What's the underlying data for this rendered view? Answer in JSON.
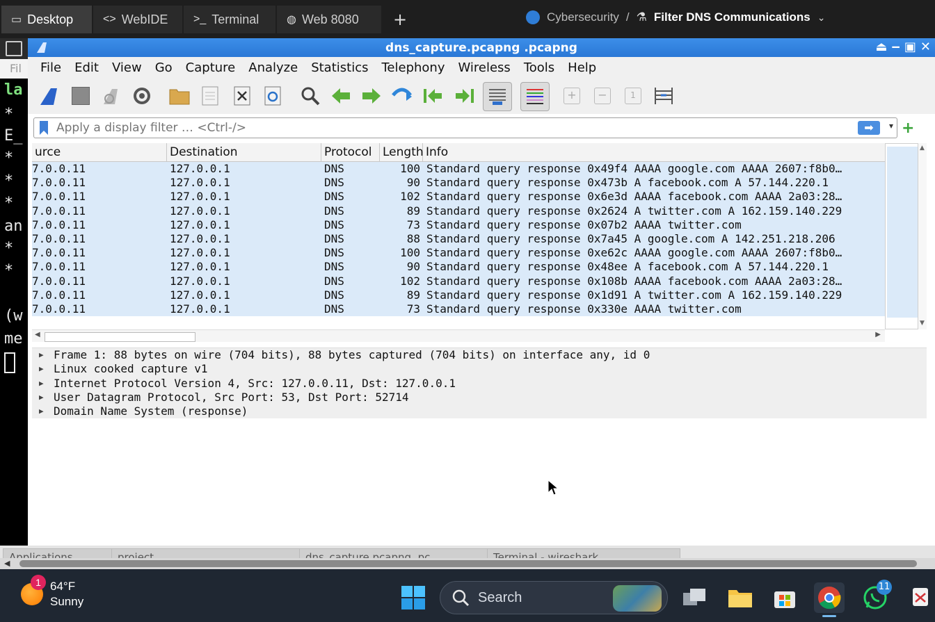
{
  "top_tabs": [
    {
      "label": "Desktop",
      "icon": "monitor-icon"
    },
    {
      "label": "WebIDE",
      "icon": "code-icon"
    },
    {
      "label": "Terminal",
      "icon": "terminal-icon"
    },
    {
      "label": "Web 8080",
      "icon": "globe-icon"
    }
  ],
  "breadcrumb": {
    "section": "Cybersecurity",
    "separator": "/",
    "current": "Filter DNS Communications"
  },
  "terminal_lines": [
    "la",
    "*",
    "E_",
    "*",
    "*",
    "*",
    "an",
    "*",
    "*",
    "(w",
    "me"
  ],
  "terminal_title_fragment": "Fil",
  "window": {
    "title": "dns_capture.pcapng .pcapng"
  },
  "menu": [
    "File",
    "Edit",
    "View",
    "Go",
    "Capture",
    "Analyze",
    "Statistics",
    "Telephony",
    "Wireless",
    "Tools",
    "Help"
  ],
  "filter": {
    "placeholder": "Apply a display filter … <Ctrl-/>"
  },
  "packet_list": {
    "columns": [
      "urce",
      "Destination",
      "Protocol",
      "Length",
      "Info"
    ],
    "rows": [
      {
        "src": "7.0.0.11",
        "dst": "127.0.0.1",
        "proto": "DNS",
        "len": "100",
        "info": "Standard query response 0x49f4 AAAA google.com AAAA 2607:f8b0…"
      },
      {
        "src": "7.0.0.11",
        "dst": "127.0.0.1",
        "proto": "DNS",
        "len": "90",
        "info": "Standard query response 0x473b A facebook.com A 57.144.220.1"
      },
      {
        "src": "7.0.0.11",
        "dst": "127.0.0.1",
        "proto": "DNS",
        "len": "102",
        "info": "Standard query response 0x6e3d AAAA facebook.com AAAA 2a03:28…"
      },
      {
        "src": "7.0.0.11",
        "dst": "127.0.0.1",
        "proto": "DNS",
        "len": "89",
        "info": "Standard query response 0x2624 A twitter.com A 162.159.140.229"
      },
      {
        "src": "7.0.0.11",
        "dst": "127.0.0.1",
        "proto": "DNS",
        "len": "73",
        "info": "Standard query response 0x07b2 AAAA twitter.com"
      },
      {
        "src": "7.0.0.11",
        "dst": "127.0.0.1",
        "proto": "DNS",
        "len": "88",
        "info": "Standard query response 0x7a45 A google.com A 142.251.218.206"
      },
      {
        "src": "7.0.0.11",
        "dst": "127.0.0.1",
        "proto": "DNS",
        "len": "100",
        "info": "Standard query response 0xe62c AAAA google.com AAAA 2607:f8b0…"
      },
      {
        "src": "7.0.0.11",
        "dst": "127.0.0.1",
        "proto": "DNS",
        "len": "90",
        "info": "Standard query response 0x48ee A facebook.com A 57.144.220.1"
      },
      {
        "src": "7.0.0.11",
        "dst": "127.0.0.1",
        "proto": "DNS",
        "len": "102",
        "info": "Standard query response 0x108b AAAA facebook.com AAAA 2a03:28…"
      },
      {
        "src": "7.0.0.11",
        "dst": "127.0.0.1",
        "proto": "DNS",
        "len": "89",
        "info": "Standard query response 0x1d91 A twitter.com A 162.159.140.229"
      },
      {
        "src": "7.0.0.11",
        "dst": "127.0.0.1",
        "proto": "DNS",
        "len": "73",
        "info": "Standard query response 0x330e AAAA twitter.com"
      }
    ]
  },
  "details": [
    "Frame 1: 88 bytes on wire (704 bits), 88 bytes captured (704 bits) on interface any, id 0",
    "Linux cooked capture v1",
    "Internet Protocol Version 4, Src: 127.0.0.11, Dst: 127.0.0.1",
    "User Datagram Protocol, Src Port: 53, Dst Port: 52714",
    "Domain Name System (response)"
  ],
  "vm_taskbar": [
    "Applications",
    "project",
    "dns_capture.pcapng .pc…",
    "Terminal - wireshark"
  ],
  "taskbar": {
    "weather": {
      "temp": "64°F",
      "condition": "Sunny",
      "badge": "1"
    },
    "search_label": "Search",
    "whatsapp_badge": "11"
  },
  "colors": {
    "selected_row": "#dbeaf9",
    "title_bar": "#2a78d6",
    "taskbar": "#1f2732"
  }
}
